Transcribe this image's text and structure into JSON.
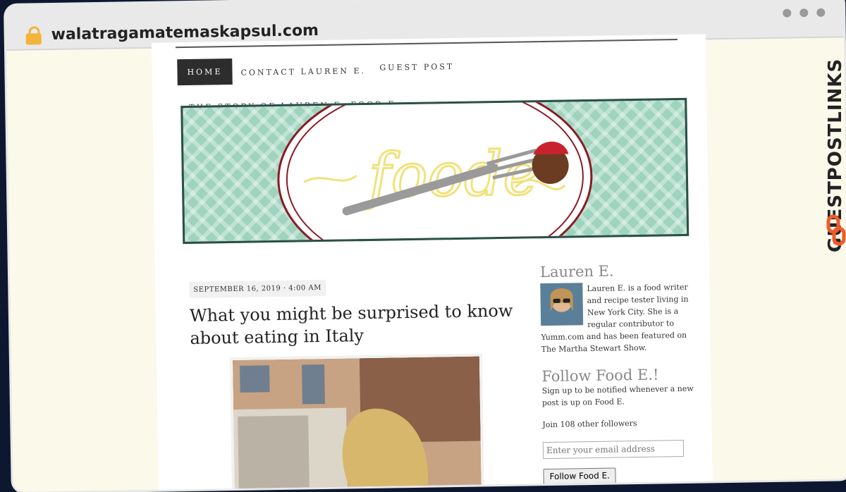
{
  "browser": {
    "url": "walatragamatemaskapsul.com",
    "window_dots": [
      "dot-1",
      "dot-2",
      "dot-3"
    ]
  },
  "nav": {
    "items": [
      {
        "label": "HOME"
      },
      {
        "label": "CONTACT LAUREN E."
      },
      {
        "label": "GUEST POST"
      },
      {
        "label": "THE STORY OF LAUREN E. FOOD E."
      }
    ],
    "active": "HOME"
  },
  "banner": {
    "logo_text": "foode",
    "colors": {
      "pattern": "#9ed3bd",
      "frame": "#2c4f48",
      "logo_yellow": "#f0e27a",
      "meatball_red": "#c8232c"
    }
  },
  "post": {
    "meta": "SEPTEMBER 16, 2019 · 4:00 AM",
    "title": "What you might be surprised to know about eating in Italy"
  },
  "sidebar": {
    "author_heading": "Lauren E.",
    "author_bio": "Lauren E. is a food writer and recipe tester living in New York City. She is a regular contributor to Yumm.com and has been featured on The Martha Stewart Show.",
    "follow_heading": "Follow Food E.!",
    "follow_text": "Sign up to be notified whenever a new post is up on Food E.",
    "followers_text": "Join 108 other followers",
    "email_placeholder": "Enter your email address",
    "follow_button": "Follow Food E."
  },
  "watermark": {
    "text": "GUESTPOSTLINKS",
    "accent": "#f05a28"
  }
}
